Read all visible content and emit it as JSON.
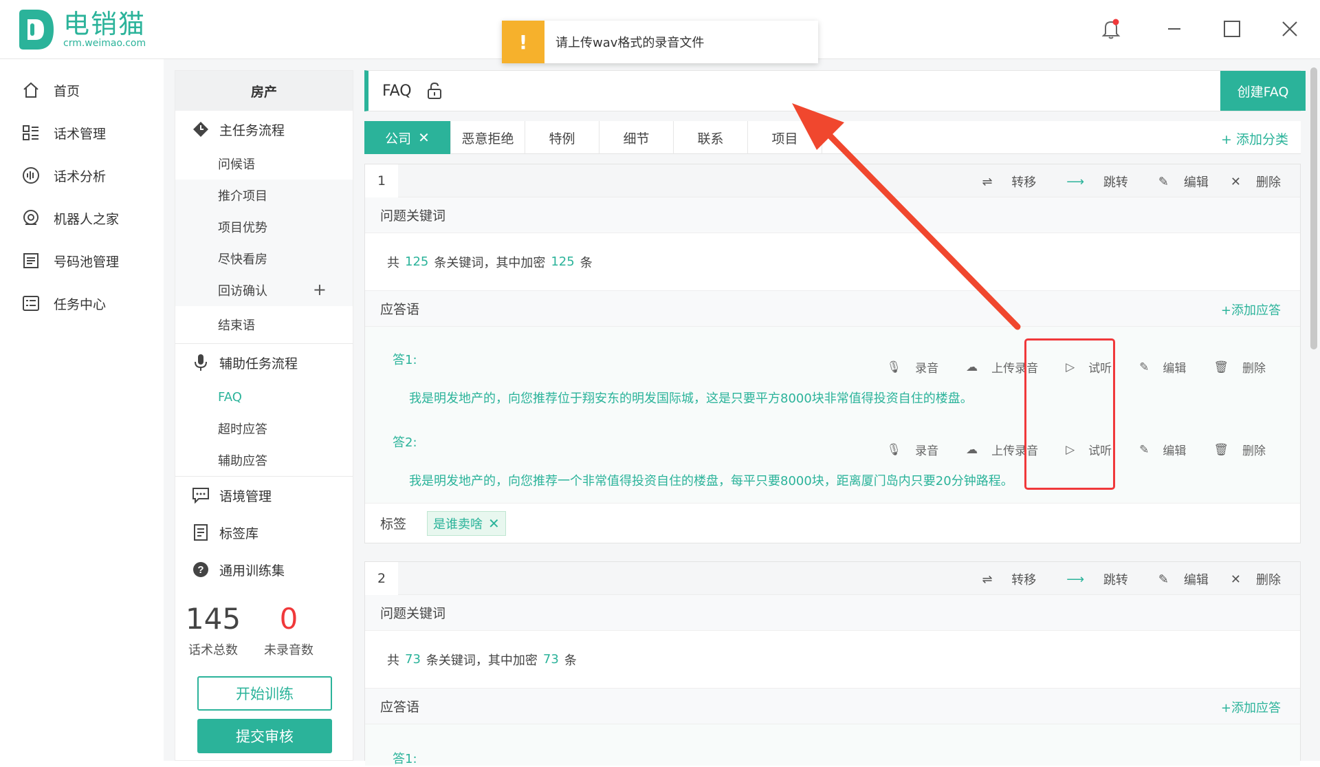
{
  "app": {
    "logo_cn": "电销猫",
    "logo_url": "crm.weimao.com"
  },
  "toast": {
    "icon": "!",
    "message": "请上传wav格式的录音文件"
  },
  "leftnav": {
    "items": [
      {
        "label": "首页",
        "icon": "home-icon"
      },
      {
        "label": "话术管理",
        "icon": "script-icon"
      },
      {
        "label": "话术分析",
        "icon": "analysis-icon"
      },
      {
        "label": "机器人之家",
        "icon": "robot-icon"
      },
      {
        "label": "号码池管理",
        "icon": "numberpool-icon"
      },
      {
        "label": "任务中心",
        "icon": "task-icon"
      }
    ]
  },
  "midpanel": {
    "header": "房产",
    "main_flow": "主任务流程",
    "main_items": [
      "问候语",
      "推介项目",
      "项目优势",
      "尽快看房",
      "回访确认",
      "结束语"
    ],
    "aux_flow": "辅助任务流程",
    "aux_items": [
      "FAQ",
      "超时应答",
      "辅助应答"
    ],
    "extra": [
      "语境管理",
      "标签库",
      "通用训练集"
    ],
    "stats": {
      "total": "145",
      "total_label": "话术总数",
      "unrecorded": "0",
      "unrecorded_label": "未录音数"
    },
    "btn_train": "开始训练",
    "btn_submit": "提交审核"
  },
  "main": {
    "title": "FAQ",
    "create_btn": "创建FAQ",
    "tabs": [
      "公司",
      "恶意拒绝",
      "特例",
      "细节",
      "联系",
      "项目"
    ],
    "tab_close": "✕",
    "add_category": "+ 添加分类",
    "card_actions": [
      "转移",
      "跳转",
      "编辑",
      "删除"
    ],
    "keyword_title": "问题关键词",
    "answer_title": "应答语",
    "add_answer": "+添加应答",
    "tag_title": "标签",
    "answer_actions": [
      "录音",
      "上传录音",
      "试听",
      "编辑",
      "删除"
    ],
    "cards": [
      {
        "index": "1",
        "kw_prefix": "共",
        "kw_count": "125",
        "kw_mid": "条关键词，其中加密",
        "kw_enc": "125",
        "kw_suffix": "条",
        "answers": [
          {
            "label": "答1:",
            "text": "我是明发地产的，向您推荐位于翔安东的明发国际城，这是只要平方8000块非常值得投资自住的楼盘。"
          },
          {
            "label": "答2:",
            "text": "我是明发地产的，向您推荐一个非常值得投资自住的楼盘，每平只要8000块，距离厦门岛内只要20分钟路程。"
          }
        ],
        "tag": "是谁卖啥"
      },
      {
        "index": "2",
        "kw_prefix": "共",
        "kw_count": "73",
        "kw_mid": "条关键词，其中加密",
        "kw_enc": "73",
        "kw_suffix": "条",
        "answers": [
          {
            "label": "答1:"
          }
        ]
      }
    ]
  },
  "colors": {
    "accent": "#2bb39a",
    "warning": "#f6b12c",
    "alert": "#f0383a"
  }
}
